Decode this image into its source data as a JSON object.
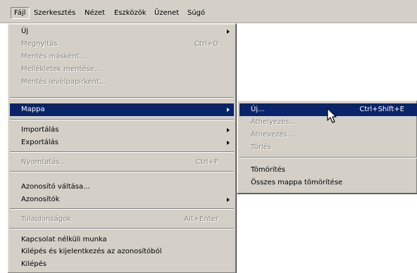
{
  "menubar": {
    "items": [
      {
        "label": "Fájl"
      },
      {
        "label": "Szerkesztés"
      },
      {
        "label": "Nézet"
      },
      {
        "label": "Eszközök"
      },
      {
        "label": "Üzenet"
      },
      {
        "label": "Súgó"
      }
    ]
  },
  "file_menu": {
    "items": [
      {
        "label": "Új",
        "shortcut": "",
        "state": "enabled",
        "submenu": true
      },
      {
        "label": "Megnyitás",
        "shortcut": "Ctrl+O",
        "state": "disabled"
      },
      {
        "label": "Mentés másként...",
        "shortcut": "",
        "state": "disabled"
      },
      {
        "label": "Mellékletek mentése...",
        "shortcut": "",
        "state": "disabled"
      },
      {
        "label": "Mentés levélpapírként...",
        "shortcut": "",
        "state": "disabled"
      },
      {
        "label": "Mappa",
        "shortcut": "",
        "state": "highlighted",
        "submenu": true
      },
      {
        "label": "Importálás",
        "shortcut": "",
        "state": "enabled",
        "submenu": true
      },
      {
        "label": "Exportálás",
        "shortcut": "",
        "state": "enabled",
        "submenu": true
      },
      {
        "label": "Nyomtatás...",
        "shortcut": "Ctrl+P",
        "state": "disabled"
      },
      {
        "label": "Azonosító váltása...",
        "shortcut": "",
        "state": "enabled"
      },
      {
        "label": "Azonosítók",
        "shortcut": "",
        "state": "enabled",
        "submenu": true
      },
      {
        "label": "Tulajdonságok",
        "shortcut": "Alt+Enter",
        "state": "disabled"
      },
      {
        "label": "Kapcsolat nélküli munka",
        "shortcut": "",
        "state": "enabled"
      },
      {
        "label": "Kilépés és kijelentkezés az azonosítóból",
        "shortcut": "",
        "state": "enabled"
      },
      {
        "label": "Kilépés",
        "shortcut": "",
        "state": "enabled"
      }
    ]
  },
  "folder_submenu": {
    "items": [
      {
        "label": "Új...",
        "shortcut": "Ctrl+Shift+E",
        "state": "highlighted"
      },
      {
        "label": "Áthelyezés...",
        "shortcut": "",
        "state": "disabled"
      },
      {
        "label": "Átnevezés...",
        "shortcut": "",
        "state": "disabled"
      },
      {
        "label": "Törlés",
        "shortcut": "",
        "state": "disabled"
      },
      {
        "label": "Tömörítés",
        "shortcut": "",
        "state": "enabled"
      },
      {
        "label": "Összes mappa tömörítése",
        "shortcut": "",
        "state": "enabled"
      }
    ]
  },
  "colors": {
    "menu_bg": "#d4d0c8",
    "highlight_bg": "#0a246a",
    "highlight_text": "#ffffff",
    "disabled_text": "#8a8781"
  },
  "cursor": {
    "icon": "arrow-pointer-icon"
  }
}
